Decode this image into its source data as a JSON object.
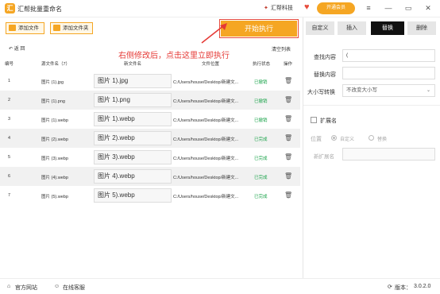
{
  "window": {
    "title": "汇帮批量重命名",
    "logo_text": "汇",
    "brand": "汇帮科技",
    "vip_label": "开通会员",
    "controls": {
      "menu": "≡",
      "minimize": "—",
      "maximize": "▭",
      "close": "✕"
    }
  },
  "toolbar": {
    "add_file": "添加文件",
    "add_folder": "添加文件夹",
    "start": "开始执行",
    "back": "↶ 返 回",
    "clear": "清空列表"
  },
  "hint": "右侧修改后，点击这里立即执行",
  "table": {
    "headers": {
      "id": "编号",
      "original": "源文件名（7）",
      "new": "新文件名",
      "path": "文件位置",
      "status": "执行状态",
      "action": "操作"
    },
    "rows": [
      {
        "id": "1",
        "original": "图片 (1).jpg",
        "new": "图片 1).jpg",
        "path": "C:/Users/house/Desktop/新建文...",
        "status": "已撤销"
      },
      {
        "id": "2",
        "original": "图片 (1).png",
        "new": "图片 1).png",
        "path": "C:/Users/house/Desktop/新建文...",
        "status": "已撤销"
      },
      {
        "id": "3",
        "original": "图片 (1).webp",
        "new": "图片 1).webp",
        "path": "C:/Users/house/Desktop/新建文...",
        "status": "已撤销"
      },
      {
        "id": "4",
        "original": "图片 (2).webp",
        "new": "图片 2).webp",
        "path": "C:/Users/house/Desktop/新建文...",
        "status": "已完成"
      },
      {
        "id": "5",
        "original": "图片 (3).webp",
        "new": "图片 3).webp",
        "path": "C:/Users/house/Desktop/新建文...",
        "status": "已完成"
      },
      {
        "id": "6",
        "original": "图片 (4).webp",
        "new": "图片 4).webp",
        "path": "C:/Users/house/Desktop/新建文...",
        "status": "已完成"
      },
      {
        "id": "7",
        "original": "图片 (5).webp",
        "new": "图片 5).webp",
        "path": "C:/Users/house/Desktop/新建文...",
        "status": "已完成"
      }
    ],
    "delete_glyph": "🗑"
  },
  "panel": {
    "tabs": [
      "自定义",
      "插入",
      "替换",
      "删除"
    ],
    "find_label": "查找内容",
    "find_value": "(",
    "replace_label": "替换内容",
    "replace_value": "",
    "case_label": "大小写转换",
    "case_value": "不改变大小写",
    "ext_label": "扩展名",
    "position_label": "位置",
    "position_custom": "自定义",
    "position_replace": "替换",
    "new_ext_label": "新扩展名"
  },
  "status_bar": {
    "website": "官方网站",
    "support": "在线客服",
    "version_label": "版本：",
    "version": "3.0.2.0"
  },
  "colors": {
    "accent": "#f5a623",
    "hint": "#e53935",
    "status_revoked": "#1aa34a",
    "status_done": "#1aa34a",
    "active_tab": "#111111"
  }
}
